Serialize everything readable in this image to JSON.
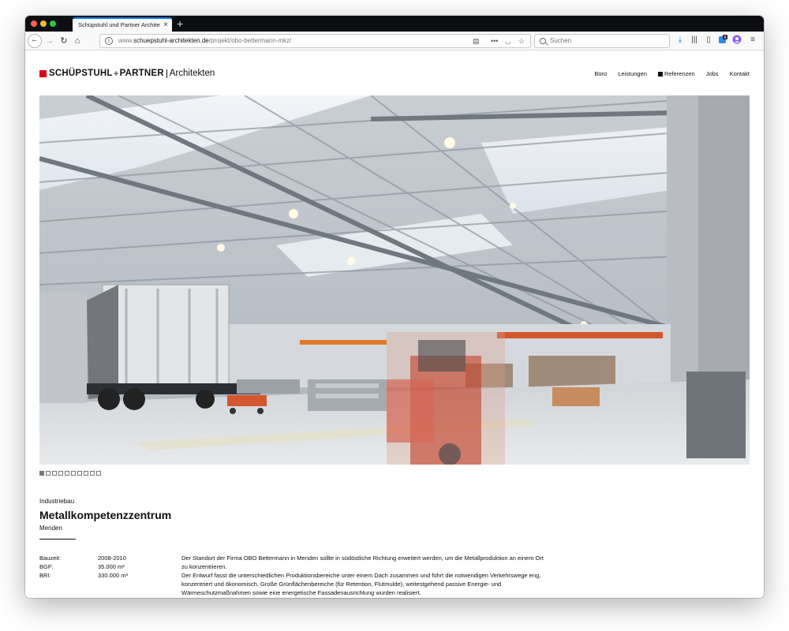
{
  "browser": {
    "tab_title": "Schüpstuhl und Partner Architekten",
    "new_tab": "+",
    "url_prefix": "www.",
    "url_domain": "schuepstuhl-architekten.de",
    "url_path": "/projekt/obo-bettermann-mkz/",
    "search_placeholder": "Suchen",
    "notification_badge": "8"
  },
  "site": {
    "logo_bold": "SCHÜPSTUHL",
    "logo_plus": "+",
    "logo_bold2": "PARTNER",
    "logo_light": "Architekten",
    "brand_color": "#e2001a",
    "nav": [
      {
        "label": "Büro"
      },
      {
        "label": "Leistungen"
      },
      {
        "label": "Referenzen",
        "active": true
      },
      {
        "label": "Jobs"
      },
      {
        "label": "Kontakt"
      }
    ]
  },
  "gallery": {
    "slide_count": 10,
    "active_slide": 1,
    "image_subject": "industrial production hall interior with forklift and trailer"
  },
  "project": {
    "category": "Industriebau",
    "title": "Metallkompetenzzentrum",
    "location": "Menden",
    "facts": [
      {
        "label": "Bauzeit:",
        "value": "2008-2010"
      },
      {
        "label": "BGF:",
        "value": "35.000 m²"
      },
      {
        "label": "BRI:",
        "value": "330.000 m³"
      }
    ],
    "description_1": "Der Standort der Firma OBO Bettermann in Menden sollte in südöstliche Richtung erweitert werden, um die Metallproduktion an einem Ort zu konzentrieren.",
    "description_2": "Der Entwurf fasst die unterschiedlichen Produktionsbereiche unter einem Dach zusammen und führt die notwendigen Verkehrswege eng, konzentriert und ökonomisch. Große Grünflächenbereiche (für Retention, Flutmulde), weitestgehend passive Energie- und Wärmeschutzmaßnahmen sowie eine energetische Fassadenausrichtung wurden realisiert."
  }
}
